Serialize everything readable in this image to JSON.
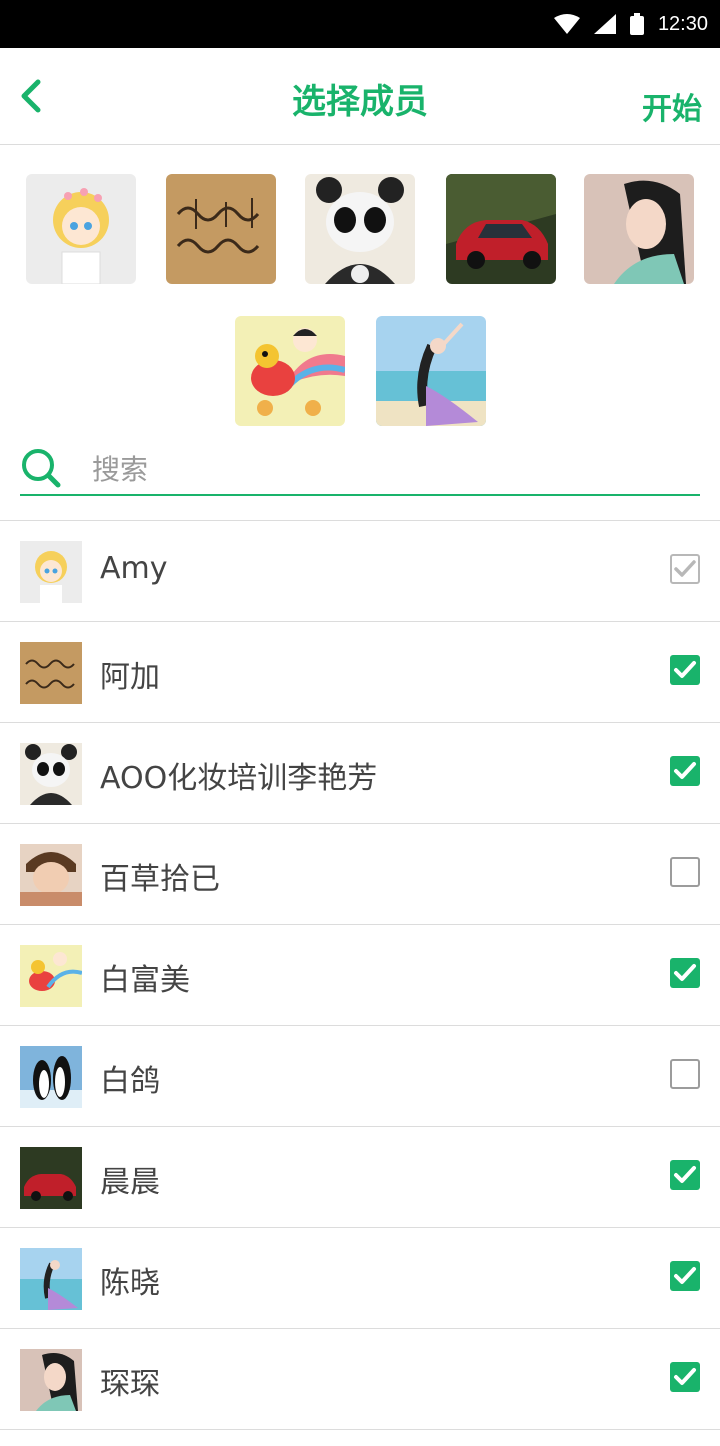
{
  "status_bar": {
    "time": "12:30"
  },
  "header": {
    "title": "选择成员",
    "start_label": "开始"
  },
  "search": {
    "placeholder": "搜索"
  },
  "selected_avatars": [
    {
      "icon": "anime-girl-avatar"
    },
    {
      "icon": "calligraphy-avatar"
    },
    {
      "icon": "panda-avatar"
    },
    {
      "icon": "red-car-avatar"
    },
    {
      "icon": "woman-photo-avatar"
    },
    {
      "icon": "cartoon-bird-avatar"
    },
    {
      "icon": "beach-dancer-avatar"
    }
  ],
  "members": [
    {
      "name": "Amy",
      "state": "disabled",
      "icon": "anime-girl-avatar"
    },
    {
      "name": "阿加",
      "state": "on",
      "icon": "calligraphy-avatar"
    },
    {
      "name": "AOO化妆培训李艳芳",
      "state": "on",
      "icon": "panda-avatar"
    },
    {
      "name": "百草拾已",
      "state": "off",
      "icon": "boy-photo-avatar"
    },
    {
      "name": "白富美",
      "state": "on",
      "icon": "cartoon-bird-avatar"
    },
    {
      "name": "白鸽",
      "state": "off",
      "icon": "penguins-avatar"
    },
    {
      "name": "晨晨",
      "state": "on",
      "icon": "red-car-avatar"
    },
    {
      "name": "陈晓",
      "state": "on",
      "icon": "beach-dancer-avatar"
    },
    {
      "name": "琛琛",
      "state": "on",
      "icon": "woman-photo-avatar"
    }
  ],
  "colors": {
    "accent": "#19b36b",
    "divider": "#dcdcdc"
  }
}
